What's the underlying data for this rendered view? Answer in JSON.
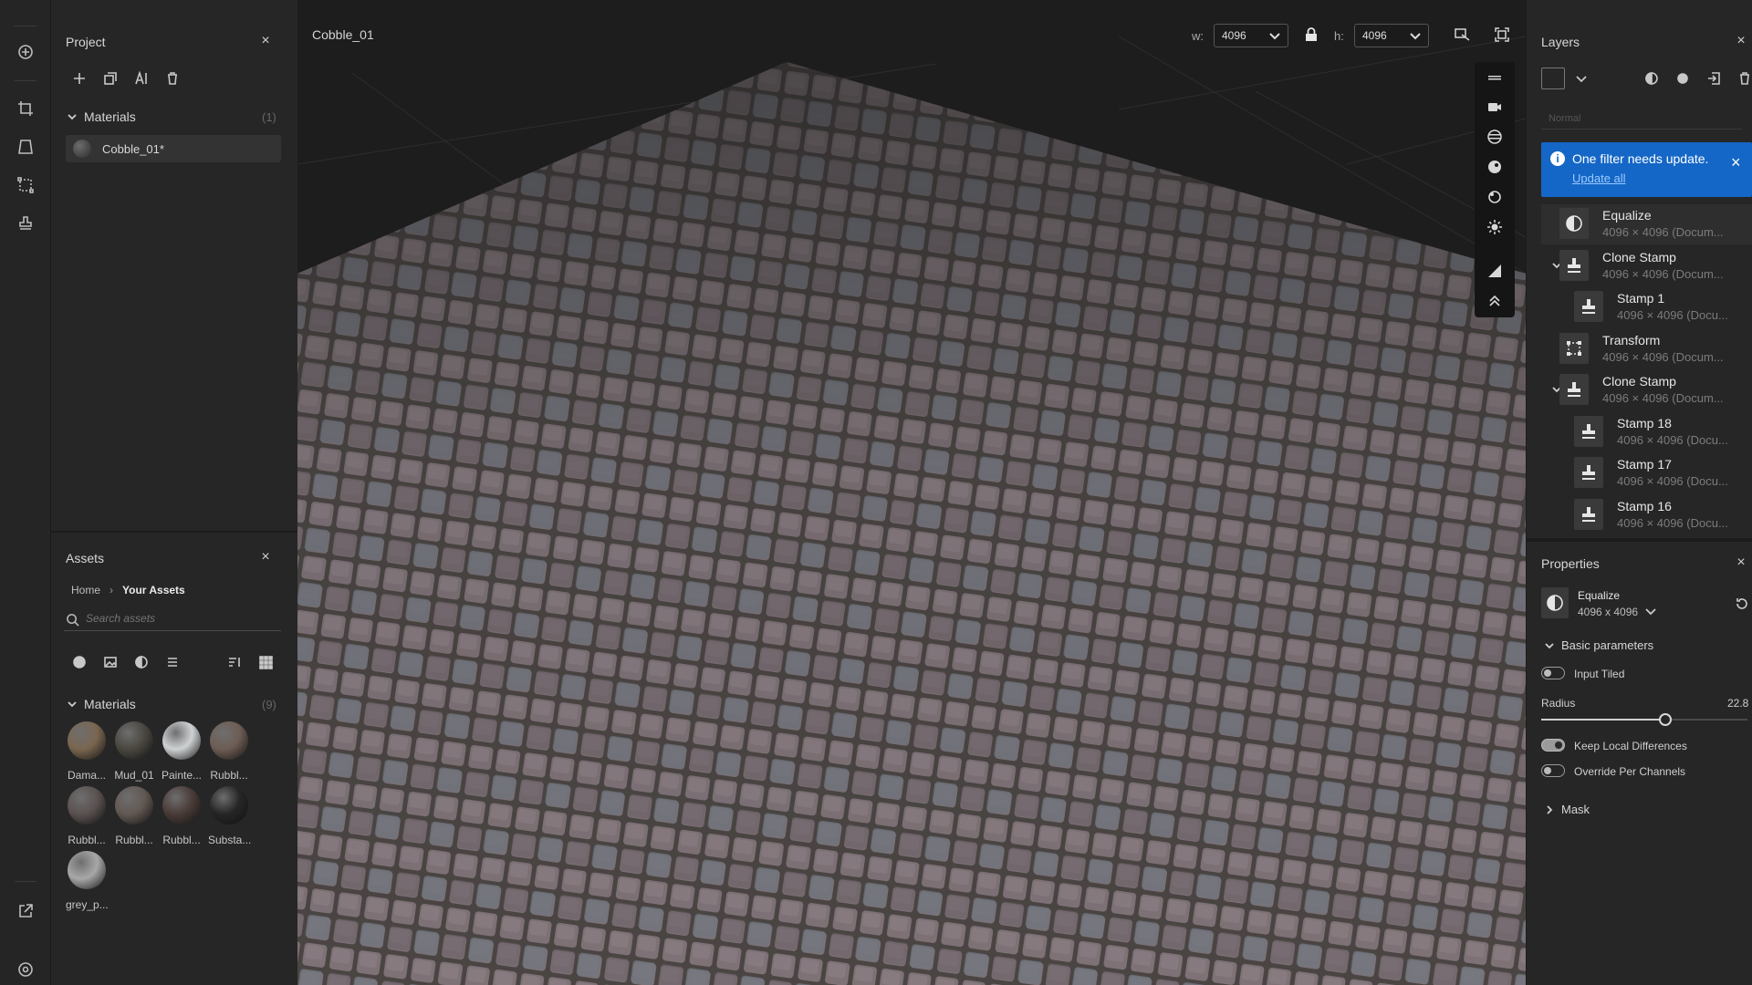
{
  "project": {
    "title": "Project",
    "materials_label": "Materials",
    "materials_count": "(1)",
    "material_item": "Cobble_01*"
  },
  "assets": {
    "title": "Assets",
    "breadcrumb_home": "Home",
    "breadcrumb_current": "Your Assets",
    "search_placeholder": "Search assets",
    "materials_label": "Materials",
    "materials_count": "(9)",
    "items": [
      "Dama...",
      "Mud_01",
      "Painte...",
      "Rubbl...",
      "Rubbl...",
      "Rubbl...",
      "Rubbl...",
      "Substa...",
      "grey_p..."
    ],
    "item_colors": [
      "#7a6650",
      "#4a4740",
      "#cfd2d4",
      "#6e5d55",
      "#5a5250",
      "#625852",
      "#4a3c38",
      "#262626",
      "#a8a8a8"
    ]
  },
  "viewport": {
    "title": "Cobble_01",
    "w_label": "w:",
    "w_value": "4096",
    "h_label": "h:",
    "h_value": "4096"
  },
  "layers": {
    "title": "Layers",
    "blend_placeholder": "Normal",
    "banner_text": "One filter needs update.",
    "banner_link": "Update all",
    "items": [
      {
        "name": "Equalize",
        "sub": "4096 × 4096 (Docum..."
      },
      {
        "name": "Clone Stamp",
        "sub": "4096 × 4096 (Docum..."
      },
      {
        "name": "Stamp 1",
        "sub": "4096 × 4096 (Docu..."
      },
      {
        "name": "Transform",
        "sub": "4096 × 4096 (Docum..."
      },
      {
        "name": "Clone Stamp",
        "sub": "4096 × 4096 (Docum..."
      },
      {
        "name": "Stamp 18",
        "sub": "4096 × 4096 (Docu..."
      },
      {
        "name": "Stamp 17",
        "sub": "4096 × 4096 (Docu..."
      },
      {
        "name": "Stamp 16",
        "sub": "4096 × 4096 (Docu..."
      }
    ]
  },
  "properties": {
    "title": "Properties",
    "filter_name": "Equalize",
    "filter_size": "4096 x 4096",
    "basic_params": "Basic parameters",
    "input_tiled": "Input Tiled",
    "input_tiled_on": false,
    "radius_label": "Radius",
    "radius_value": "22.8",
    "radius_level": 0.6,
    "keep_local": "Keep Local Differences",
    "keep_local_on": true,
    "override": "Override Per Channels",
    "override_on": false,
    "mask": "Mask"
  },
  "colors": {
    "accent": "#1467c6",
    "panel": "#262626",
    "viewport": "#1d1d1d"
  }
}
